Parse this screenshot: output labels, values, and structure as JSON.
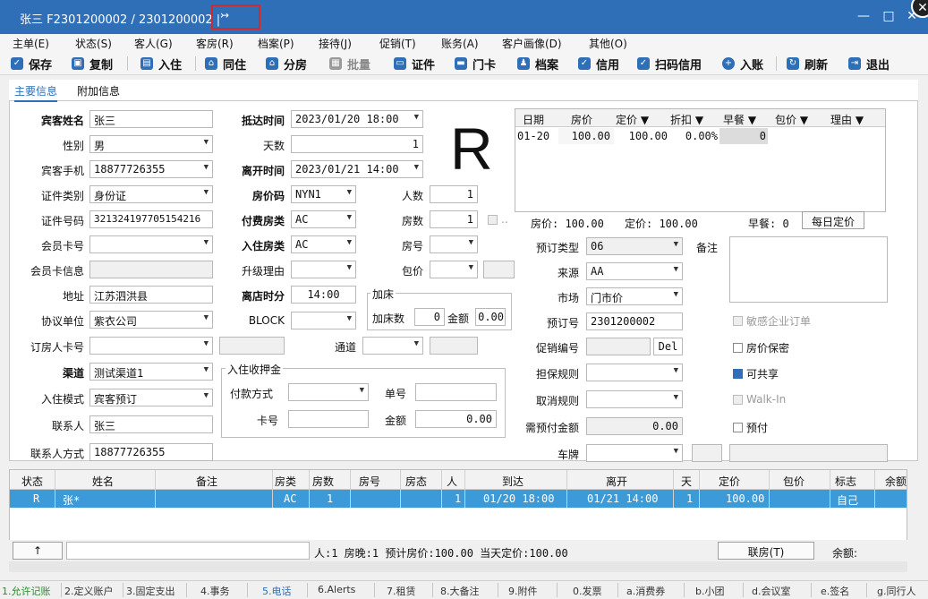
{
  "window": {
    "title": "张三 F2301200002 / 2301200002 |",
    "title_badge": "↣",
    "min_icon": "minimize-icon",
    "max_icon": "maximize-icon",
    "close_icon": "close-icon",
    "min": "—",
    "max": "□",
    "close": "✕"
  },
  "menu": [
    "主单(E)",
    "状态(S)",
    "客人(G)",
    "客房(R)",
    "档案(P)",
    "接待(J)",
    "促销(T)",
    "账务(A)",
    "客户画像(D)",
    "其他(O)"
  ],
  "toolbar": [
    {
      "label": "保存",
      "icon": "check-icon",
      "glyph": "✓"
    },
    {
      "label": "复制",
      "icon": "copy-icon",
      "glyph": "▣"
    },
    {
      "label": "入住",
      "icon": "checkin-icon",
      "glyph": "▤"
    },
    {
      "label": "同住",
      "icon": "home-icon",
      "glyph": "⌂"
    },
    {
      "label": "分房",
      "icon": "house-icon",
      "glyph": "⌂"
    },
    {
      "label": "批量",
      "icon": "batch-icon",
      "glyph": "▦"
    },
    {
      "label": "证件",
      "icon": "id-card-icon",
      "glyph": "▭"
    },
    {
      "label": "门卡",
      "icon": "card-icon",
      "glyph": "▬"
    },
    {
      "label": "档案",
      "icon": "profile-icon",
      "glyph": "♟"
    },
    {
      "label": "信用",
      "icon": "shield-icon",
      "glyph": "✓"
    },
    {
      "label": "扫码信用",
      "icon": "scan-shield-icon",
      "glyph": "✓"
    },
    {
      "label": "入账",
      "icon": "plus-circle-icon",
      "glyph": "+"
    },
    {
      "label": "刷新",
      "icon": "refresh-icon",
      "glyph": "↻"
    },
    {
      "label": "退出",
      "icon": "exit-icon",
      "glyph": "⇥"
    }
  ],
  "tabs": {
    "main": "主要信息",
    "extra": "附加信息"
  },
  "form": {
    "guest_name_label": "宾客姓名",
    "guest_name": "张三",
    "gender_label": "性别",
    "gender": "男",
    "phone_label": "宾客手机",
    "phone": "18877726355",
    "id_type_label": "证件类别",
    "id_type": "身份证",
    "id_no_label": "证件号码",
    "id_no": "321324197705154216",
    "member_card_label": "会员卡号",
    "member_card": "",
    "member_info_label": "会员卡信息",
    "address_label": "地址",
    "address": "江苏泗洪县",
    "company_label": "协议单位",
    "company": "紫衣公司",
    "booker_card_label": "订房人卡号",
    "channel_label": "渠道",
    "channel": "测试渠道1",
    "checkin_mode_label": "入住模式",
    "checkin_mode": "宾客预订",
    "contact_label": "联系人",
    "contact": "张三",
    "contact_method_label": "联系人方式",
    "contact_method": "18877726355",
    "arrive_label": "抵达时间",
    "arrive": "2023/01/20 18:00",
    "days_label": "天数",
    "days": "1",
    "leave_label": "离开时间",
    "leave": "2023/01/21 14:00",
    "rate_code_label": "房价码",
    "rate_code": "NYN1",
    "persons_label": "人数",
    "persons": "1",
    "pay_room_label": "付费房类",
    "pay_room": "AC",
    "rooms_label": "房数",
    "rooms": "1",
    "room_type_label": "入住房类",
    "room_type": "AC",
    "room_no_label": "房号",
    "upgrade_label": "升级理由",
    "package_label": "包价",
    "leave_time_label": "离店时分",
    "leave_time": "14:00",
    "block_label": "BLOCK",
    "channel2_label": "通道",
    "status_big": "R",
    "extra_bed_title": "加床",
    "extra_bed_count_label": "加床数",
    "extra_bed_count": "0",
    "extra_bed_amount_label": "金额",
    "extra_bed_amount": "0.00",
    "deposit_title": "入住收押金",
    "pay_method_label": "付款方式",
    "order_no_label": "单号",
    "card_no_label": "卡号",
    "amount_label": "金额",
    "amount": "0.00",
    "booking_type_label": "预订类型",
    "booking_type": "06",
    "source_label": "来源",
    "source": "AA",
    "market_label": "市场",
    "market": "门市价",
    "booking_no_label": "预订号",
    "booking_no": "2301200002",
    "promo_label": "促销编号",
    "promo_del": "Del",
    "guarantee_label": "担保规则",
    "cancel_label": "取消规则",
    "prepay_label": "需预付金额",
    "prepay": "0.00",
    "plate_label": "车牌",
    "remark_label": "备注",
    "ellipsis": "..",
    "cb_sensitive": "敏感企业订单",
    "cb_secret": "房价保密",
    "cb_share": "可共享",
    "cb_walkin": "Walk-In",
    "cb_prepay": "预付"
  },
  "daily_grid": {
    "headers": [
      "日期",
      "房价",
      "定价 ▼",
      "折扣 ▼",
      "早餐 ▼",
      "包价 ▼",
      "理由 ▼"
    ],
    "rows": [
      [
        "01-20",
        "100.00",
        "100.00",
        "0.00%",
        "0",
        "",
        ""
      ]
    ],
    "summary_rate": "房价: 100.00",
    "summary_fixed": "定价: 100.00",
    "summary_breakfast": "早餐: 0",
    "daily_btn": "每日定价"
  },
  "guest_grid": {
    "headers": [
      "状态",
      "姓名",
      "备注",
      "房类",
      "房数",
      "房号",
      "房态",
      "人",
      "到达",
      "离开",
      "天",
      "定价",
      "包价",
      "标志",
      "余额"
    ],
    "rows": [
      [
        "R",
        "张*",
        "",
        "AC",
        "1",
        "",
        "",
        "1",
        "01/20 18:00",
        "01/21 14:00",
        "1",
        "100.00",
        "",
        "自己",
        ""
      ]
    ]
  },
  "footer": {
    "up_arrow": "↑",
    "summary": "人:1  房晚:1  预计房价:100.00  当天定价:100.00",
    "joint_btn": "联房(T)",
    "balance": "余额:"
  },
  "statusbar": [
    "1.允许记账",
    "2.定义账户",
    "3.固定支出",
    "4.事务",
    "5.电话",
    "6.Alerts",
    "7.租赁",
    "8.大备注",
    "9.附件",
    "0.发票",
    "a.消费券",
    "b.小团",
    "d.会议室",
    "e.签名",
    "g.同行人"
  ]
}
